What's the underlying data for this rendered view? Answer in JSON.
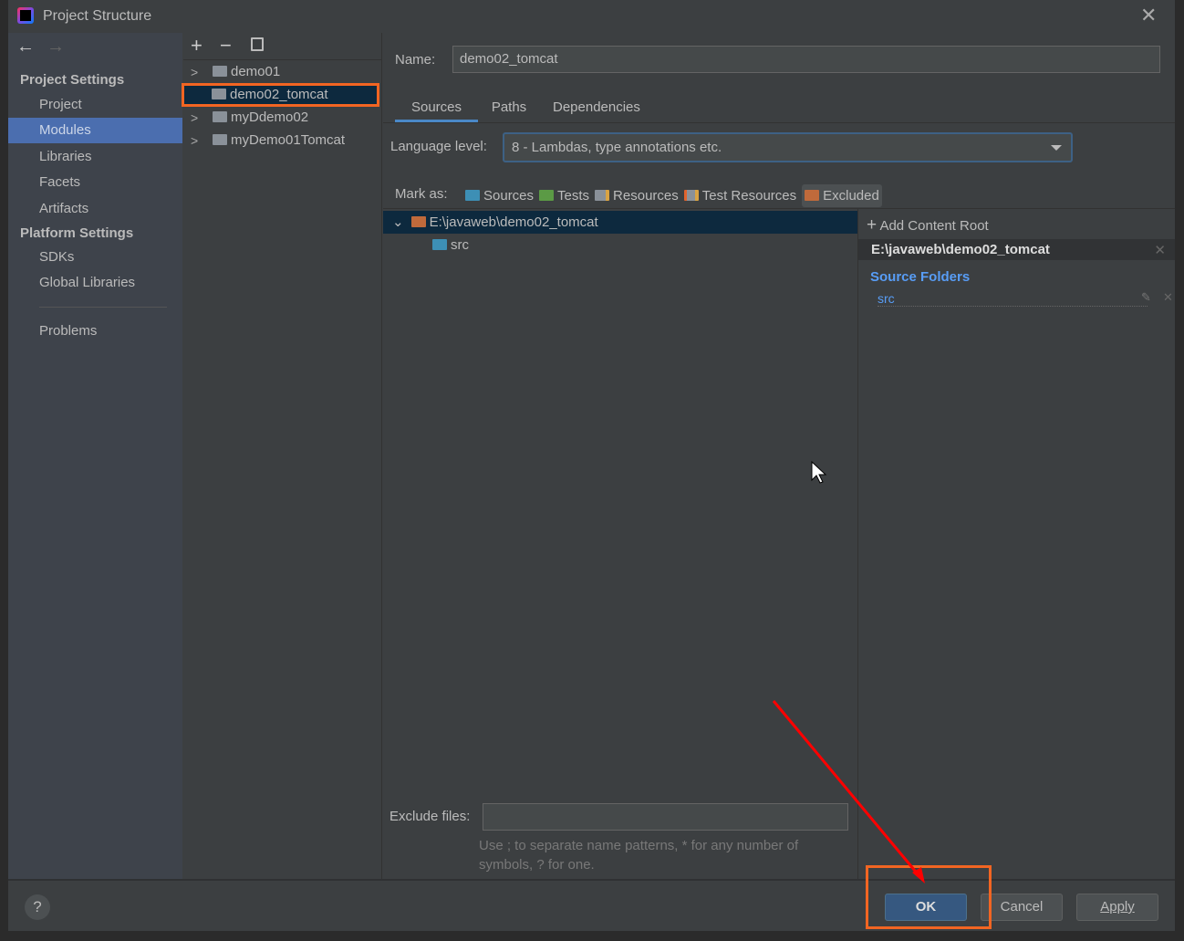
{
  "window": {
    "title": "Project Structure"
  },
  "sidebar": {
    "project_settings_header": "Project Settings",
    "project_items": [
      {
        "label": "Project"
      },
      {
        "label": "Modules",
        "selected": true
      },
      {
        "label": "Libraries"
      },
      {
        "label": "Facets"
      },
      {
        "label": "Artifacts"
      }
    ],
    "platform_settings_header": "Platform Settings",
    "platform_items": [
      {
        "label": "SDKs"
      },
      {
        "label": "Global Libraries"
      }
    ],
    "problems": "Problems"
  },
  "modules": {
    "items": [
      {
        "label": "demo01"
      },
      {
        "label": "demo02_tomcat",
        "selected": true
      },
      {
        "label": "myDdemo02"
      },
      {
        "label": "myDemo01Tomcat"
      }
    ]
  },
  "main": {
    "name_label": "Name:",
    "name_value": "demo02_tomcat",
    "tabs": [
      {
        "label": "Sources",
        "active": true
      },
      {
        "label": "Paths"
      },
      {
        "label": "Dependencies"
      }
    ],
    "language_level_label": "Language level:",
    "language_level_value": "8 - Lambdas, type annotations etc.",
    "mark_as_label": "Mark as:",
    "mark_as": [
      {
        "label": "Sources",
        "color": "#3d8fb5"
      },
      {
        "label": "Tests",
        "color": "#5b9a45"
      },
      {
        "label": "Resources",
        "color": "#8a9199"
      },
      {
        "label": "Test Resources",
        "color": "#8a9199"
      },
      {
        "label": "Excluded",
        "color": "#c06a3b"
      }
    ],
    "tree": {
      "root": "E:\\javaweb\\demo02_tomcat",
      "child": "src"
    },
    "content_root": {
      "add_label": "Add Content Root",
      "path": "E:\\javaweb\\demo02_tomcat",
      "source_folders_header": "Source Folders",
      "source_folder": "src"
    },
    "exclude_files_label": "Exclude files:",
    "exclude_files_value": "",
    "hint_line1": "Use ; to separate name patterns, * for any number of",
    "hint_line2": "symbols, ? for one."
  },
  "buttons": {
    "ok": "OK",
    "cancel": "Cancel",
    "apply": "Apply",
    "help": "?"
  },
  "colors": {
    "selection": "#4b6eaf",
    "highlight_box": "#f26522",
    "annotation_arrow": "#ff0000",
    "link": "#589df6"
  }
}
